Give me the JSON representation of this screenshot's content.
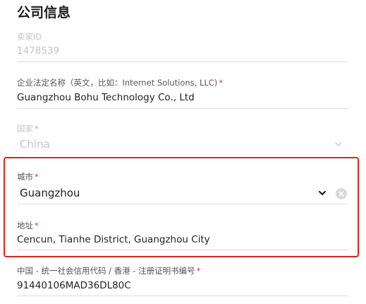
{
  "section": {
    "title": "公司信息"
  },
  "seller_id": {
    "label": "卖家ID",
    "value": "1478539"
  },
  "legal_name": {
    "label": "企业法定名称（英文，比如：Internet Solutions, LLC)",
    "required": "*",
    "value": "Guangzhou Bohu Technology Co., Ltd"
  },
  "country": {
    "label": "国家",
    "required": "*",
    "value": "China"
  },
  "city": {
    "label": "城市",
    "required": "*",
    "value": "Guangzhou"
  },
  "address": {
    "label": "地址",
    "required": "*",
    "value": "Cencun, Tianhe District, Guangzhou City"
  },
  "registration_code": {
    "label": "中国 - 统一社会信用代码 / 香港 - 注册证明书编号",
    "required": "*",
    "value": "91440106MAD36DL80C"
  },
  "colors": {
    "highlight_border": "#e2231a",
    "required_mark": "#d9363e",
    "disabled_text": "#c4c4c4"
  },
  "icons": {
    "country_dropdown": "chevron-down-icon",
    "city_dropdown": "chevron-down-icon",
    "city_clear": "clear-icon"
  }
}
